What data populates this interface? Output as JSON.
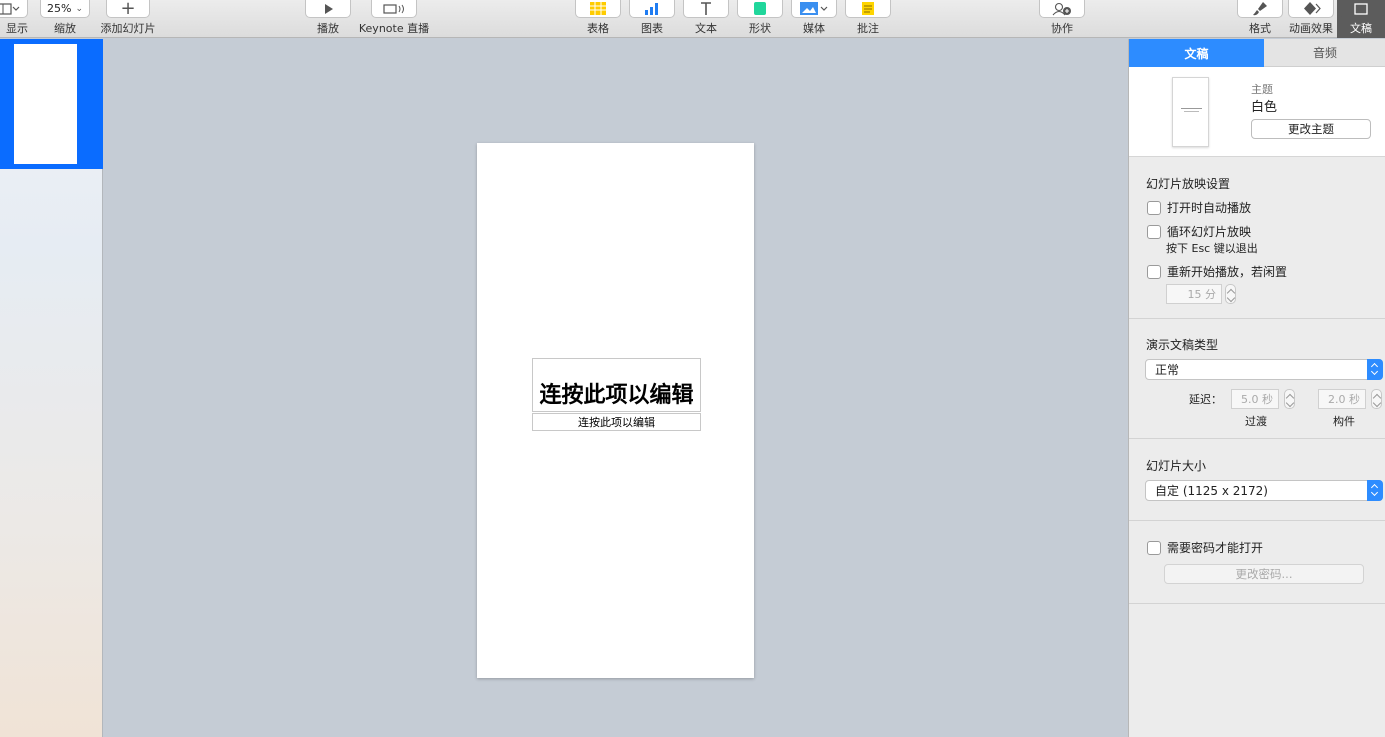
{
  "toolbar": {
    "view_label": "显示",
    "zoom_value": "25%",
    "zoom_label": "缩放",
    "add_slide_label": "添加幻灯片",
    "play_label": "播放",
    "keynote_live_label": "Keynote 直播",
    "table_label": "表格",
    "chart_label": "图表",
    "text_label": "文本",
    "shape_label": "形状",
    "media_label": "媒体",
    "comment_label": "批注",
    "collaborate_label": "协作",
    "format_label": "格式",
    "animate_label": "动画效果",
    "document_label": "文稿",
    "colors": {
      "table": "#ffcc00",
      "chart": "#1f7cf2",
      "shape": "#20d69b",
      "media": "#3a8ff0",
      "comment": "#ffd500"
    }
  },
  "slide": {
    "title_placeholder": "连按此项以编辑",
    "subtitle_placeholder": "连按此项以编辑"
  },
  "inspector": {
    "tabs": [
      "文稿",
      "音频"
    ],
    "theme_label": "主题",
    "theme_value": "白色",
    "change_theme_button": "更改主题",
    "playback_section": "幻灯片放映设置",
    "autoplay_label": "打开时自动播放",
    "loop_label": "循环幻灯片放映",
    "loop_hint": "按下 Esc 键以退出",
    "restart_label": "重新开始播放，若闲置",
    "idle_minutes": "15 分",
    "presentation_type_section": "演示文稿类型",
    "presentation_type_value": "正常",
    "delay_label": "延迟：",
    "transition_delay": "5.0 秒",
    "build_delay": "2.0 秒",
    "transition_label": "过渡",
    "build_label": "构件",
    "slide_size_section": "幻灯片大小",
    "slide_size_value": "自定 (1125 x 2172)",
    "password_label": "需要密码才能打开",
    "change_password_button": "更改密码..."
  }
}
